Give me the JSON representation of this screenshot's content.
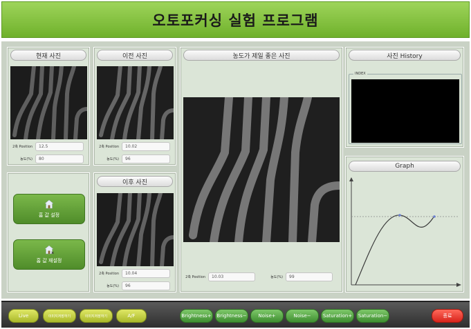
{
  "app": {
    "title": "오토포커싱 실험 프로그램"
  },
  "current_photo": {
    "header": "현재 사진",
    "position_label": "2축 Position",
    "position_value": "12.5",
    "density_label": "농도(%)",
    "density_value": "80"
  },
  "previous_photo": {
    "header": "이전 사진",
    "position_label": "2축 Position",
    "position_value": "10.02",
    "density_label": "농도(%)",
    "density_value": "96"
  },
  "next_photo": {
    "header": "이후 사진",
    "position_label": "2축 Position",
    "position_value": "10.04",
    "density_label": "농도(%)",
    "density_value": "96"
  },
  "settings": {
    "set_label": "홈 값 설정",
    "reset_label": "홈 값 재설정",
    "set_icon": "house-icon",
    "reset_icon": "house-reset-icon"
  },
  "best_photo": {
    "header": "농도가 제일 좋은 사진",
    "position_label": "2축 Position",
    "position_value": "10.03",
    "density_label": "농도(%)",
    "density_value": "99"
  },
  "history": {
    "header": "사진 History",
    "index_label": "INDEX"
  },
  "graph": {
    "header": "Graph",
    "curve_color": "#3a3a3a",
    "point_color": "#6b7fcf",
    "dotted_color": "#8a8a8a"
  },
  "toolbar": {
    "live": "Live",
    "save1": "이미지저장하기",
    "save2": "이미지저장하기",
    "af": "A/F",
    "brightness_up": "Brightness+",
    "brightness_down": "Brightness−",
    "noise_up": "Noise+",
    "noise_down": "Noise−",
    "saturation_up": "Saturation+",
    "saturation_down": "Saturation−",
    "exit": "종료"
  }
}
